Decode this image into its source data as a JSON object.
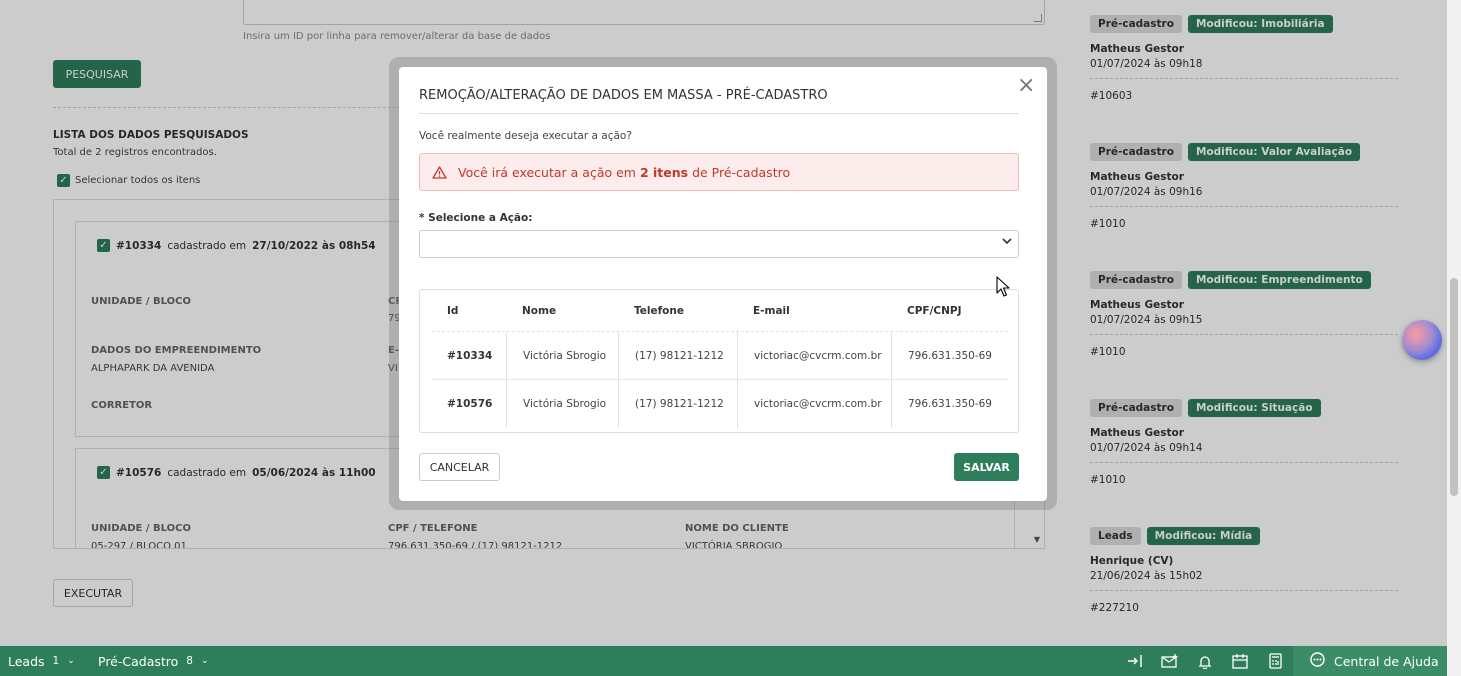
{
  "background": {
    "hint": "Insira um ID por linha para remover/alterar da base de dados",
    "search_button": "PESQUISAR",
    "list_title": "LISTA DOS DADOS PESQUISADOS",
    "list_count": "Total de 2 registros encontrados.",
    "select_all": "Selecionar todos os itens",
    "cards": [
      {
        "id": "#10334",
        "registered_text": "cadastrado em",
        "date": "27/10/2022 às 08h54",
        "label_unit": "UNIDADE / BLOCO",
        "label_cpf_partial": "CP",
        "value_cpf_partial": "79",
        "label_development": "DADOS DO EMPREENDIMENTO",
        "value_development": "ALPHAPARK DA AVENIDA",
        "label_email_partial": "E-",
        "value_email_partial": "VI",
        "label_broker": "CORRETOR"
      },
      {
        "id": "#10576",
        "registered_text": "cadastrado em",
        "date": "05/06/2024 às 11h00",
        "label_unit": "UNIDADE / BLOCO",
        "value_unit": "05-297 / BLOCO 01",
        "label_cpf_phone": "CPF / TELEFONE",
        "value_cpf_phone": "796.631.350-69 / (17) 98121-1212",
        "label_client": "NOME DO CLIENTE",
        "value_client": "VICTÓRIA SBROGIO"
      }
    ],
    "execute_button": "EXECUTAR"
  },
  "activity": [
    {
      "type": "Pré-cadastro",
      "change": "Modificou: Imobiliária",
      "user": "Matheus Gestor",
      "date": "01/07/2024 às 09h18",
      "id": "#10603"
    },
    {
      "type": "Pré-cadastro",
      "change": "Modificou: Valor Avaliação",
      "user": "Matheus Gestor",
      "date": "01/07/2024 às 09h16",
      "id": "#1010"
    },
    {
      "type": "Pré-cadastro",
      "change": "Modificou: Empreendimento",
      "user": "Matheus Gestor",
      "date": "01/07/2024 às 09h15",
      "id": "#1010"
    },
    {
      "type": "Pré-cadastro",
      "change": "Modificou: Situação",
      "user": "Matheus Gestor",
      "date": "01/07/2024 às 09h14",
      "id": "#1010"
    },
    {
      "type": "Leads",
      "change": "Modificou: Mídia",
      "user": "Henrique (CV)",
      "date": "21/06/2024 às 15h02",
      "id": "#227210"
    }
  ],
  "bottom_bar": {
    "leads_label": "Leads",
    "leads_count": "1",
    "precadastro_label": "Pré-Cadastro",
    "precadastro_count": "8",
    "help_label": "Central de Ajuda"
  },
  "modal": {
    "title": "REMOÇÃO/ALTERAÇÃO DE DADOS EM MASSA - PRÉ-CADASTRO",
    "question": "Você realmente deseja executar a ação?",
    "alert_prefix": "Você irá executar a ação em",
    "alert_count": "2 itens",
    "alert_suffix": "de Pré-cadastro",
    "action_label": "* Selecione a Ação:",
    "action_value": "",
    "table": {
      "headers": [
        "Id",
        "Nome",
        "Telefone",
        "E-mail",
        "CPF/CNPJ"
      ],
      "rows": [
        [
          "#10334",
          "Victória Sbrogio",
          "(17) 98121-1212",
          "victoriac@cvcrm.com.br",
          "796.631.350-69"
        ],
        [
          "#10576",
          "Victória Sbrogio",
          "(17) 98121-1212",
          "victoriac@cvcrm.com.br",
          "796.631.350-69"
        ]
      ]
    },
    "cancel_button": "CANCELAR",
    "save_button": "SALVAR"
  },
  "colors": {
    "primary_green": "#2e7d5b",
    "alert_red": "#c0392b",
    "alert_bg": "#fdecec"
  }
}
